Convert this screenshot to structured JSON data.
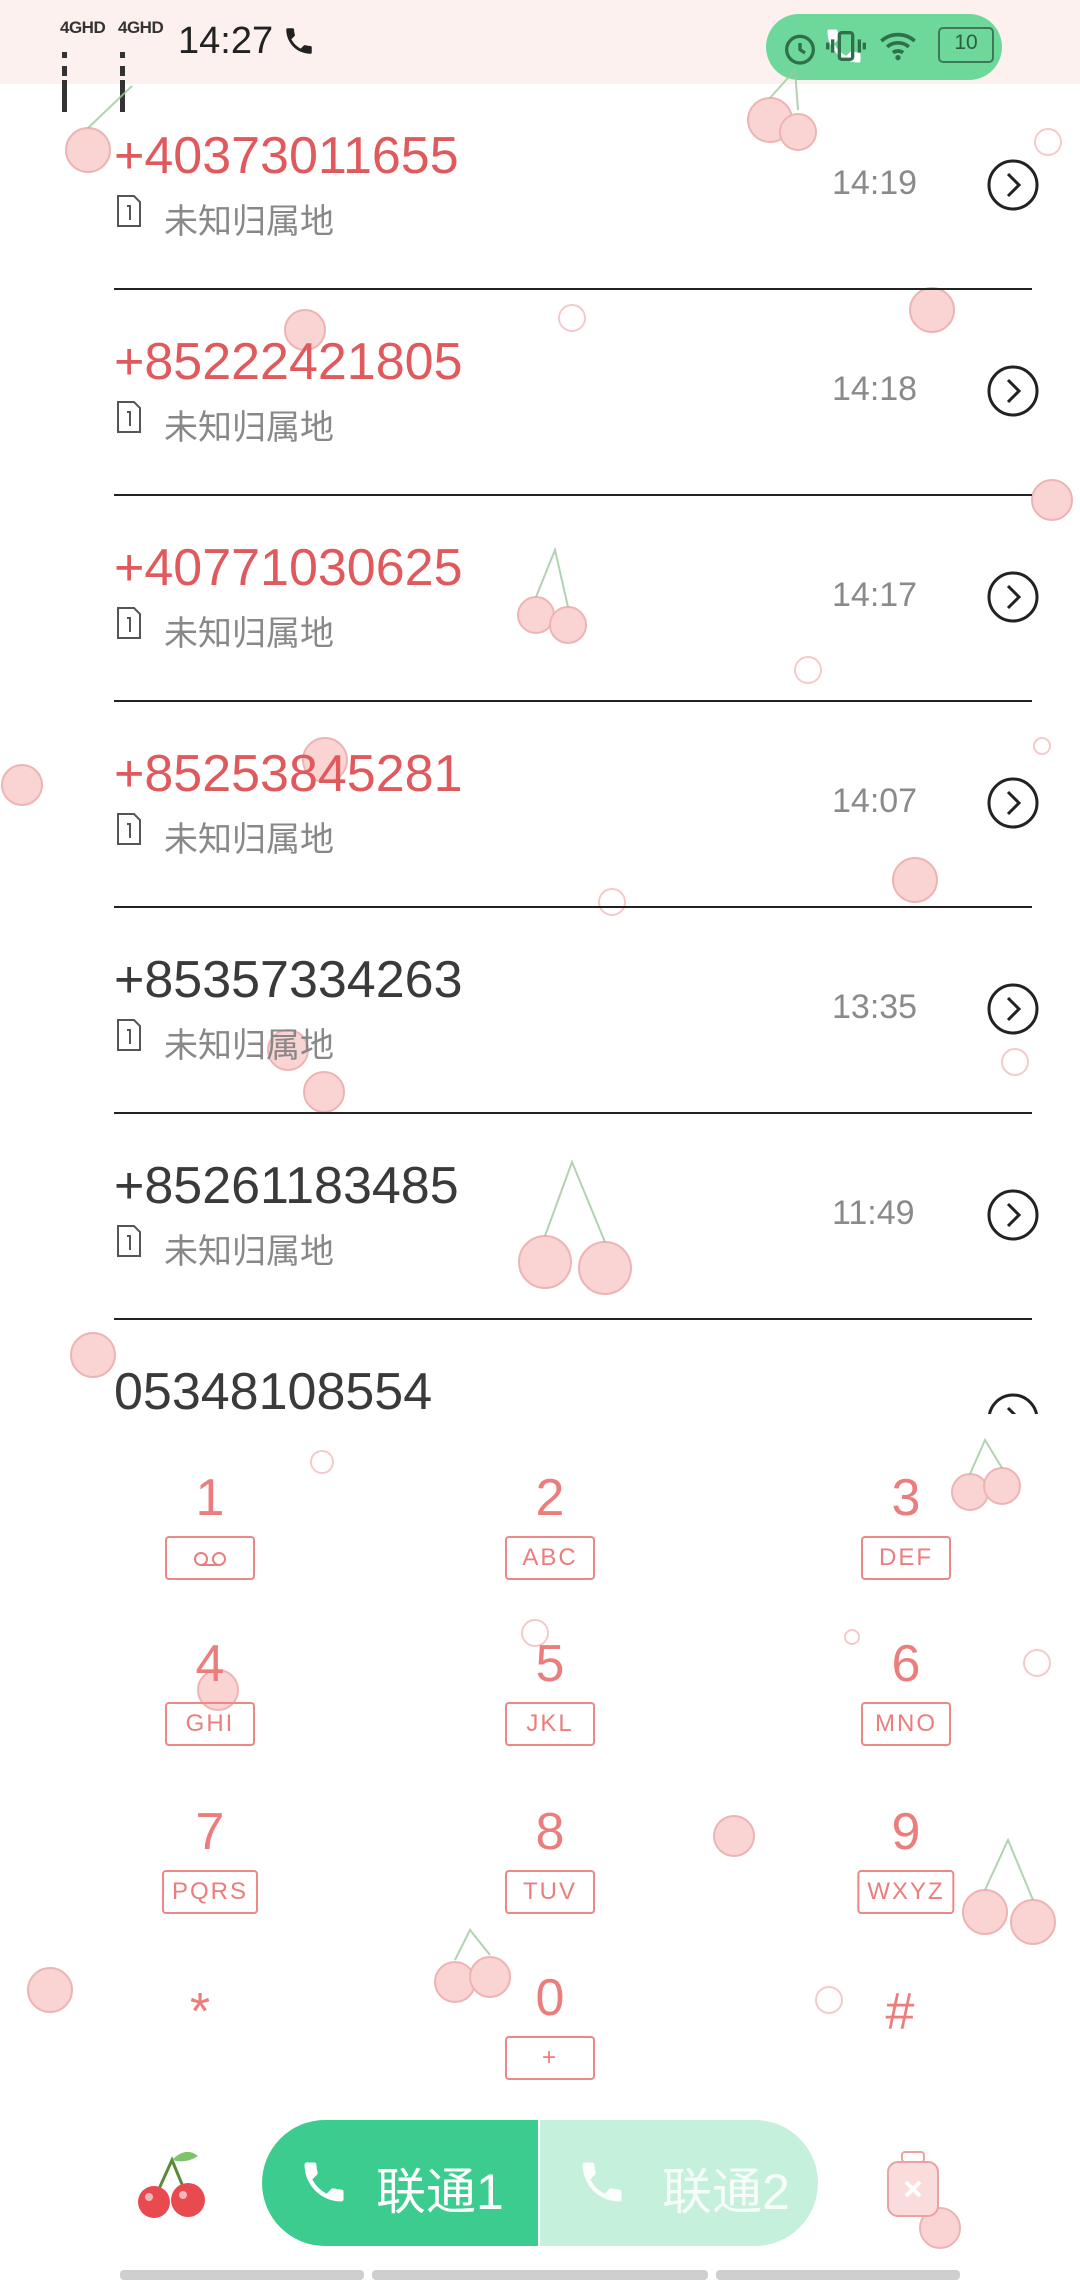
{
  "status_bar": {
    "sim1_label": "4GHD",
    "sim2_label": "4GHD",
    "time": "14:27",
    "battery": "10"
  },
  "call_log": [
    {
      "number": "+40373011655",
      "location": "未知归属地",
      "time": "14:19",
      "missed": true
    },
    {
      "number": "+85222421805",
      "location": "未知归属地",
      "time": "14:18",
      "missed": true
    },
    {
      "number": "+40771030625",
      "location": "未知归属地",
      "time": "14:17",
      "missed": true
    },
    {
      "number": "+85253845281",
      "location": "未知归属地",
      "time": "14:07",
      "missed": true
    },
    {
      "number": "+85357334263",
      "location": "未知归属地",
      "time": "13:35",
      "missed": false
    },
    {
      "number": "+85261183485",
      "location": "未知归属地",
      "time": "11:49",
      "missed": false
    },
    {
      "number": "05348108554",
      "location": "",
      "time": "",
      "missed": false
    }
  ],
  "dialpad": [
    {
      "digit": "1",
      "letters": "oo"
    },
    {
      "digit": "2",
      "letters": "ABC"
    },
    {
      "digit": "3",
      "letters": "DEF"
    },
    {
      "digit": "4",
      "letters": "GHI"
    },
    {
      "digit": "5",
      "letters": "JKL"
    },
    {
      "digit": "6",
      "letters": "MNO"
    },
    {
      "digit": "7",
      "letters": "PQRS"
    },
    {
      "digit": "8",
      "letters": "TUV"
    },
    {
      "digit": "9",
      "letters": "WXYZ"
    },
    {
      "digit": "*",
      "letters": ""
    },
    {
      "digit": "0",
      "letters": "+"
    },
    {
      "digit": "#",
      "letters": ""
    }
  ],
  "call_buttons": {
    "sim1": "联通1",
    "sim2": "联通2"
  },
  "colors": {
    "missed": "#e0595c",
    "accent": "#3ccc8f",
    "dialpad": "#ec7d7d"
  }
}
